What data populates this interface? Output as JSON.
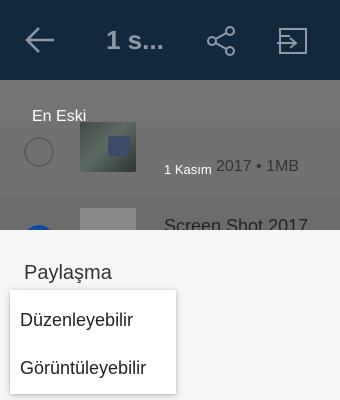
{
  "appbar": {
    "title": "1 s...",
    "icons": {
      "back": "back-arrow-icon",
      "share": "share-icon",
      "move": "move-to-icon"
    }
  },
  "list": {
    "sort_label": "En Eski",
    "rows": [
      {
        "meta": "2017 • 1MB",
        "date_tooltip": "1 Kasım",
        "selected": false
      },
      {
        "name": "Screen Shot 2017",
        "selected": true
      }
    ]
  },
  "sheet": {
    "title": "Paylaşma",
    "options": [
      "Düzenleyebilir",
      "Görüntüleyebilir"
    ]
  }
}
